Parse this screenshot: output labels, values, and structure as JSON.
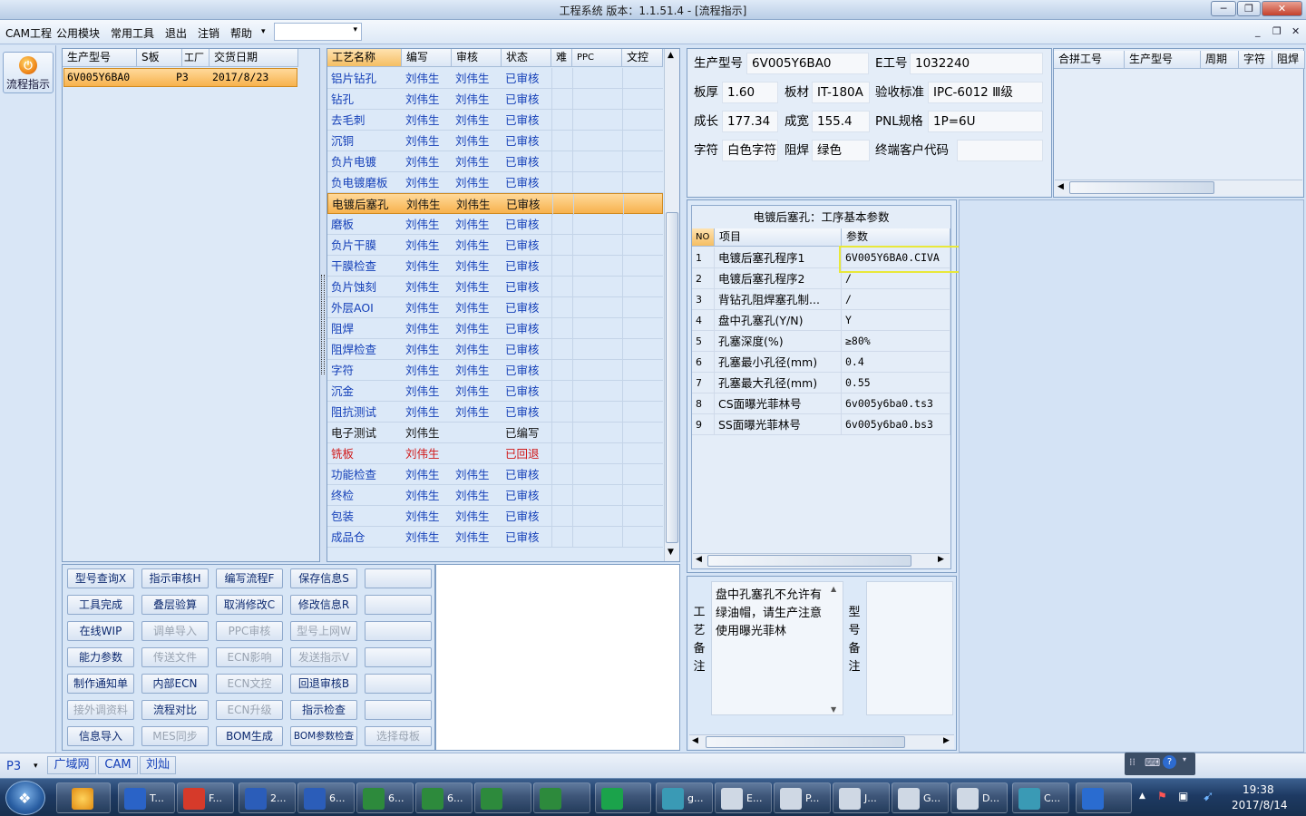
{
  "window": {
    "title": "工程系统   版本：1.1.51.4 - [流程指示]"
  },
  "menu": {
    "items": [
      "CAM工程",
      "公用模块",
      "常用工具",
      "退出",
      "注销",
      "帮助"
    ],
    "help_arrow": "▾"
  },
  "side": {
    "flow_button": "流程指示"
  },
  "orders": {
    "columns": [
      "生产型号",
      "S板",
      "工厂",
      "交货日期"
    ],
    "rows": [
      [
        "6V005Y6BA0",
        "",
        "P3",
        "2017/8/23"
      ]
    ]
  },
  "process": {
    "columns": [
      "工艺名称",
      "编写",
      "审核",
      "状态",
      "难",
      "PPC",
      "文控"
    ],
    "rows": [
      {
        "name": "铝片钻孔",
        "writer": "刘伟生",
        "auditor": "刘伟生",
        "status": "已审核"
      },
      {
        "name": "钻孔",
        "writer": "刘伟生",
        "auditor": "刘伟生",
        "status": "已审核"
      },
      {
        "name": "去毛刺",
        "writer": "刘伟生",
        "auditor": "刘伟生",
        "status": "已审核"
      },
      {
        "name": "沉铜",
        "writer": "刘伟生",
        "auditor": "刘伟生",
        "status": "已审核"
      },
      {
        "name": "负片电镀",
        "writer": "刘伟生",
        "auditor": "刘伟生",
        "status": "已审核"
      },
      {
        "name": "负电镀磨板",
        "writer": "刘伟生",
        "auditor": "刘伟生",
        "status": "已审核"
      },
      {
        "name": "电镀后塞孔",
        "writer": "刘伟生",
        "auditor": "刘伟生",
        "status": "已审核"
      },
      {
        "name": "磨板",
        "writer": "刘伟生",
        "auditor": "刘伟生",
        "status": "已审核"
      },
      {
        "name": "负片干膜",
        "writer": "刘伟生",
        "auditor": "刘伟生",
        "status": "已审核"
      },
      {
        "name": "干膜检查",
        "writer": "刘伟生",
        "auditor": "刘伟生",
        "status": "已审核"
      },
      {
        "name": "负片蚀刻",
        "writer": "刘伟生",
        "auditor": "刘伟生",
        "status": "已审核"
      },
      {
        "name": "外层AOI",
        "writer": "刘伟生",
        "auditor": "刘伟生",
        "status": "已审核"
      },
      {
        "name": "阻焊",
        "writer": "刘伟生",
        "auditor": "刘伟生",
        "status": "已审核"
      },
      {
        "name": "阻焊检查",
        "writer": "刘伟生",
        "auditor": "刘伟生",
        "status": "已审核"
      },
      {
        "name": "字符",
        "writer": "刘伟生",
        "auditor": "刘伟生",
        "status": "已审核"
      },
      {
        "name": "沉金",
        "writer": "刘伟生",
        "auditor": "刘伟生",
        "status": "已审核"
      },
      {
        "name": "阻抗测试",
        "writer": "刘伟生",
        "auditor": "刘伟生",
        "status": "已审核"
      },
      {
        "name": "电子测试",
        "writer": "刘伟生",
        "auditor": "",
        "status": "已编写"
      },
      {
        "name": "铣板",
        "writer": "刘伟生",
        "auditor": "",
        "status": "已回退"
      },
      {
        "name": "功能检查",
        "writer": "刘伟生",
        "auditor": "刘伟生",
        "status": "已审核"
      },
      {
        "name": "终检",
        "writer": "刘伟生",
        "auditor": "刘伟生",
        "status": "已审核"
      },
      {
        "name": "包装",
        "writer": "刘伟生",
        "auditor": "刘伟生",
        "status": "已审核"
      },
      {
        "name": "成品仓",
        "writer": "刘伟生",
        "auditor": "刘伟生",
        "status": "已审核"
      }
    ],
    "selected_index": 6,
    "colors": {
      "approved": "#1540b8",
      "returned": "#d11818",
      "written": "#111111"
    }
  },
  "actions": [
    [
      {
        "label": "型号查询X",
        "enabled": true
      },
      {
        "label": "指示审核H",
        "enabled": true
      },
      {
        "label": "编写流程F",
        "enabled": true
      },
      {
        "label": "保存信息S",
        "enabled": true
      },
      {
        "label": "",
        "enabled": true
      }
    ],
    [
      {
        "label": "工具完成",
        "enabled": true
      },
      {
        "label": "叠层验算",
        "enabled": true
      },
      {
        "label": "取消修改C",
        "enabled": true
      },
      {
        "label": "修改信息R",
        "enabled": true
      },
      {
        "label": "",
        "enabled": true
      }
    ],
    [
      {
        "label": "在线WIP",
        "enabled": true
      },
      {
        "label": "调单导入",
        "enabled": false
      },
      {
        "label": "PPC审核",
        "enabled": false
      },
      {
        "label": "型号上网W",
        "enabled": false
      },
      {
        "label": "",
        "enabled": true
      }
    ],
    [
      {
        "label": "能力参数",
        "enabled": true
      },
      {
        "label": "传送文件",
        "enabled": false
      },
      {
        "label": "ECN影响",
        "enabled": false
      },
      {
        "label": "发送指示V",
        "enabled": false
      },
      {
        "label": "",
        "enabled": true
      }
    ],
    [
      {
        "label": "制作通知单",
        "enabled": true
      },
      {
        "label": "内部ECN",
        "enabled": true
      },
      {
        "label": "ECN文控",
        "enabled": false
      },
      {
        "label": "回退审核B",
        "enabled": true
      },
      {
        "label": "",
        "enabled": true
      }
    ],
    [
      {
        "label": "接外调资料",
        "enabled": false
      },
      {
        "label": "流程对比",
        "enabled": true
      },
      {
        "label": "ECN升级",
        "enabled": false
      },
      {
        "label": "指示检查",
        "enabled": true
      },
      {
        "label": "",
        "enabled": true
      }
    ],
    [
      {
        "label": "信息导入",
        "enabled": true
      },
      {
        "label": "MES同步",
        "enabled": false
      },
      {
        "label": "BOM生成",
        "enabled": true
      },
      {
        "label": "BOM参数检查",
        "enabled": true
      },
      {
        "label": "选择母板",
        "enabled": false
      }
    ]
  ],
  "info": {
    "model_label": "生产型号",
    "model": "6V005Y6BA0",
    "eno_label": "E工号",
    "eno": "1032240",
    "thickness_label": "板厚",
    "thickness": "1.60",
    "material_label": "板材",
    "material": "IT-180A",
    "standard_label": "验收标准",
    "standard": "IPC-6012 Ⅲ级",
    "length_label": "成长",
    "length": "177.34",
    "width_label": "成宽",
    "width": "155.4",
    "pnl_label": "PNL规格",
    "pnl": "1P=6U",
    "char_label": "字符",
    "char": "白色字符",
    "mask_label": "阻焊",
    "mask": "绿色",
    "customer_label": "终端客户代码",
    "customer": ""
  },
  "merge": {
    "columns": [
      "合拼工号",
      "生产型号",
      "周期",
      "字符",
      "阻焊"
    ]
  },
  "params": {
    "title": "电镀后塞孔：工序基本参数",
    "columns": [
      "NO",
      "项目",
      "参数"
    ],
    "rows": [
      [
        "1",
        "电镀后塞孔程序1",
        "6V005Y6BA0.CIVA"
      ],
      [
        "2",
        "电镀后塞孔程序2",
        "/"
      ],
      [
        "3",
        "背钻孔阻焊塞孔制...",
        "/"
      ],
      [
        "4",
        "盘中孔塞孔(Y/N)",
        "Y"
      ],
      [
        "5",
        "孔塞深度(%)",
        "≥80%"
      ],
      [
        "6",
        "孔塞最小孔径(mm)",
        "0.4"
      ],
      [
        "7",
        "孔塞最大孔径(mm)",
        "0.55"
      ],
      [
        "8",
        "CS面曝光菲林号",
        "6v005y6ba0.ts3"
      ],
      [
        "9",
        "SS面曝光菲林号",
        "6v005y6ba0.bs3"
      ]
    ],
    "highlight_color": "#e8e83a"
  },
  "notes": {
    "process_label": "工艺备注",
    "process_text": "盘中孔塞孔不允许有绿油帽，请生产注意使用曝光菲林",
    "model_label": "型号备注"
  },
  "status": {
    "plant": "P3",
    "tabs": [
      "广域网",
      "CAM",
      "刘灿"
    ]
  },
  "taskbar": {
    "items": [
      {
        "label": "T...",
        "color": "#2a63c7"
      },
      {
        "label": "F...",
        "color": "#d63a2a"
      },
      {
        "label": "2...",
        "color": "#2b5db9"
      },
      {
        "label": "6...",
        "color": "#2b5db9"
      },
      {
        "label": "6...",
        "color": "#2d8a3c"
      },
      {
        "label": "6...",
        "color": "#2d8a3c"
      },
      {
        "label": "",
        "color": "#2d8a3c"
      },
      {
        "label": "",
        "color": "#2d8a3c"
      },
      {
        "label": "",
        "color": "#1ba34b"
      },
      {
        "label": "g...",
        "color": "#3a9ab5"
      },
      {
        "label": "E...",
        "color": "#cfd8e4"
      },
      {
        "label": "P...",
        "color": "#cfd8e4"
      },
      {
        "label": "J...",
        "color": "#cfd8e4"
      },
      {
        "label": "G...",
        "color": "#cfd8e4"
      },
      {
        "label": "D...",
        "color": "#cfd8e4"
      },
      {
        "label": "C...",
        "color": "#3a9ab5"
      },
      {
        "label": "",
        "color": "#2a6cd0"
      }
    ],
    "time": "19:38",
    "date": "2017/8/14"
  }
}
